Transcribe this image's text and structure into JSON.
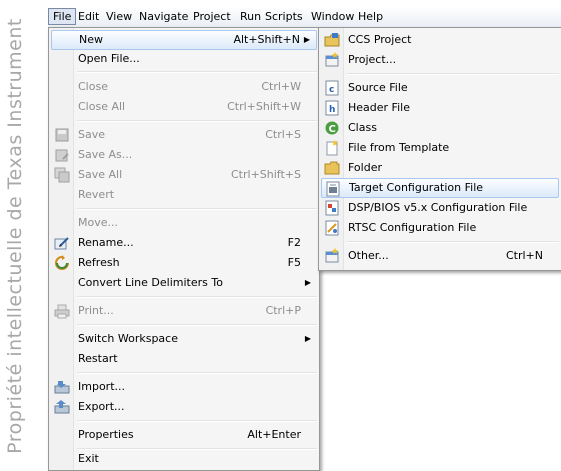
{
  "watermark": "Propriété intellectuelle de Texas Instrument",
  "menubar": {
    "items": [
      "File",
      "Edit",
      "View",
      "Navigate",
      "Project",
      "Run",
      "Scripts",
      "Window",
      "Help"
    ]
  },
  "file_menu": {
    "items": [
      {
        "label": "New",
        "shortcut": "Alt+Shift+N",
        "submenu": true,
        "state": "highlighted"
      },
      {
        "label": "Open File...",
        "shortcut": "",
        "state": "enabled"
      },
      {
        "label": "Close",
        "shortcut": "Ctrl+W",
        "state": "disabled"
      },
      {
        "label": "Close All",
        "shortcut": "Ctrl+Shift+W",
        "state": "disabled"
      },
      {
        "label": "Save",
        "shortcut": "Ctrl+S",
        "state": "disabled",
        "icon": "save-icon"
      },
      {
        "label": "Save As...",
        "shortcut": "",
        "state": "disabled",
        "icon": "save-as-icon"
      },
      {
        "label": "Save All",
        "shortcut": "Ctrl+Shift+S",
        "state": "disabled",
        "icon": "save-all-icon"
      },
      {
        "label": "Revert",
        "shortcut": "",
        "state": "disabled"
      },
      {
        "label": "Move...",
        "shortcut": "",
        "state": "disabled"
      },
      {
        "label": "Rename...",
        "shortcut": "F2",
        "state": "enabled",
        "icon": "rename-icon"
      },
      {
        "label": "Refresh",
        "shortcut": "F5",
        "state": "enabled",
        "icon": "refresh-icon"
      },
      {
        "label": "Convert Line Delimiters To",
        "shortcut": "",
        "submenu": true,
        "state": "enabled"
      },
      {
        "label": "Print...",
        "shortcut": "Ctrl+P",
        "state": "disabled",
        "icon": "print-icon"
      },
      {
        "label": "Switch Workspace",
        "shortcut": "",
        "submenu": true,
        "state": "enabled"
      },
      {
        "label": "Restart",
        "shortcut": "",
        "state": "enabled"
      },
      {
        "label": "Import...",
        "shortcut": "",
        "state": "enabled",
        "icon": "import-icon"
      },
      {
        "label": "Export...",
        "shortcut": "",
        "state": "enabled",
        "icon": "export-icon"
      },
      {
        "label": "Properties",
        "shortcut": "Alt+Enter",
        "state": "enabled"
      },
      {
        "label": "Exit",
        "shortcut": "",
        "state": "enabled"
      }
    ]
  },
  "new_submenu": {
    "items": [
      {
        "label": "CCS Project",
        "shortcut": "",
        "icon": "ccs-project-icon"
      },
      {
        "label": "Project...",
        "shortcut": "",
        "icon": "project-icon"
      },
      {
        "label": "Source File",
        "shortcut": "",
        "icon": "source-file-icon"
      },
      {
        "label": "Header File",
        "shortcut": "",
        "icon": "header-file-icon"
      },
      {
        "label": "Class",
        "shortcut": "",
        "icon": "class-icon"
      },
      {
        "label": "File from Template",
        "shortcut": "",
        "icon": "file-template-icon"
      },
      {
        "label": "Folder",
        "shortcut": "",
        "icon": "folder-icon"
      },
      {
        "label": "Target Configuration File",
        "shortcut": "",
        "icon": "target-config-icon",
        "state": "highlighted"
      },
      {
        "label": "DSP/BIOS v5.x Configuration File",
        "shortcut": "",
        "icon": "dsp-bios-icon"
      },
      {
        "label": "RTSC Configuration File",
        "shortcut": "",
        "icon": "rtsc-config-icon"
      },
      {
        "label": "Other...",
        "shortcut": "Ctrl+N",
        "icon": "other-icon"
      }
    ]
  }
}
